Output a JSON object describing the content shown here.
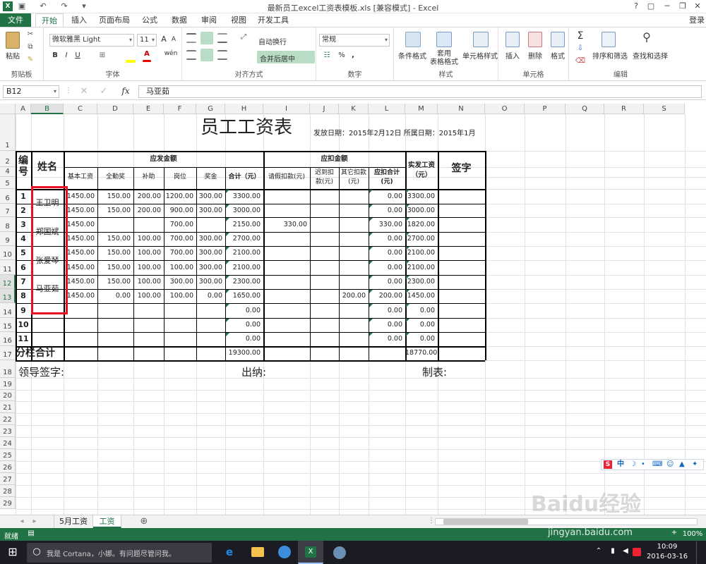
{
  "window": {
    "title": "最新员工excel工资表模板.xls  [兼容模式] - Excel",
    "help": "?",
    "login": "登录"
  },
  "tabs": [
    "文件",
    "开始",
    "插入",
    "页面布局",
    "公式",
    "数据",
    "审阅",
    "视图",
    "开发工具"
  ],
  "ribbon": {
    "clipboard": {
      "paste": "粘贴",
      "label": "剪贴板"
    },
    "font": {
      "name": "微软雅黑 Light",
      "size": "11",
      "label": "字体",
      "bold": "B",
      "italic": "I",
      "underline": "U",
      "grow": "A",
      "shrink": "A",
      "phonetic": "wén"
    },
    "align": {
      "wrap": "自动换行",
      "merge": "合并后居中",
      "label": "对齐方式"
    },
    "number": {
      "format": "常规",
      "label": "数字",
      "percent": "%",
      "comma": ","
    },
    "styles": {
      "cond": "条件格式",
      "table": "套用\n表格格式",
      "cell": "单元格样式",
      "label": "样式"
    },
    "cells": {
      "insert": "插入",
      "delete": "删除",
      "format": "格式",
      "label": "单元格"
    },
    "edit": {
      "sort": "排序和筛选",
      "find": "查找和选择",
      "label": "编辑",
      "sum": "Σ"
    }
  },
  "formula_bar": {
    "name_box": "B12",
    "fx": "fx",
    "value": "马亚茹"
  },
  "columns": [
    "A",
    "B",
    "C",
    "D",
    "E",
    "F",
    "G",
    "H",
    "I",
    "J",
    "K",
    "L",
    "M",
    "N",
    "O",
    "P",
    "Q",
    "R",
    "S"
  ],
  "rows": [
    "1",
    "2",
    "4",
    "5",
    "6",
    "7",
    "8",
    "9",
    "10",
    "11",
    "12",
    "13",
    "14",
    "15",
    "16",
    "17",
    "18",
    "19",
    "20",
    "21",
    "22",
    "23",
    "24",
    "25",
    "26",
    "27",
    "28",
    "29"
  ],
  "sheet": {
    "title": "员工工资表",
    "issue_date": "发放日期：2015年2月12日 所属日期：2015年1月",
    "h_no": "编\n号",
    "h_name": "姓名",
    "h_pay": "应发金额",
    "h_deduct": "应扣金额",
    "h_actual": "实发工资\n（元）",
    "h_sign": "签字",
    "sub": [
      "基本工资",
      "全勤奖",
      "补助",
      "岗位",
      "奖金",
      "合计（元）",
      "请假扣款(元)",
      "迟到扣\n款(元)",
      "其它扣款\n(元)",
      "应扣合计\n(元)"
    ],
    "rows": [
      {
        "no": "1",
        "base": "1450.00",
        "full": "150.00",
        "sub": "200.00",
        "post": "1200.00",
        "bonus": "300.00",
        "total": "3300.00",
        "leave": "",
        "late": "",
        "other": "",
        "ded": "0.00",
        "actual": "3300.00"
      },
      {
        "no": "2",
        "base": "1450.00",
        "full": "150.00",
        "sub": "200.00",
        "post": "900.00",
        "bonus": "300.00",
        "total": "3000.00",
        "leave": "",
        "late": "",
        "other": "",
        "ded": "0.00",
        "actual": "3000.00"
      },
      {
        "no": "3",
        "base": "1450.00",
        "full": "",
        "sub": "",
        "post": "700.00",
        "bonus": "",
        "total": "2150.00",
        "leave": "330.00",
        "late": "",
        "other": "",
        "ded": "330.00",
        "actual": "1820.00"
      },
      {
        "no": "4",
        "base": "1450.00",
        "full": "150.00",
        "sub": "100.00",
        "post": "700.00",
        "bonus": "300.00",
        "total": "2700.00",
        "leave": "",
        "late": "",
        "other": "",
        "ded": "0.00",
        "actual": "2700.00"
      },
      {
        "no": "5",
        "base": "1450.00",
        "full": "150.00",
        "sub": "100.00",
        "post": "700.00",
        "bonus": "300.00",
        "total": "2100.00",
        "leave": "",
        "late": "",
        "other": "",
        "ded": "0.00",
        "actual": "2100.00"
      },
      {
        "no": "6",
        "base": "1450.00",
        "full": "150.00",
        "sub": "100.00",
        "post": "100.00",
        "bonus": "300.00",
        "total": "2100.00",
        "leave": "",
        "late": "",
        "other": "",
        "ded": "0.00",
        "actual": "2100.00"
      },
      {
        "no": "7",
        "base": "1450.00",
        "full": "150.00",
        "sub": "100.00",
        "post": "300.00",
        "bonus": "300.00",
        "total": "2300.00",
        "leave": "",
        "late": "",
        "other": "",
        "ded": "0.00",
        "actual": "2300.00"
      },
      {
        "no": "8",
        "base": "1450.00",
        "full": "0.00",
        "sub": "100.00",
        "post": "100.00",
        "bonus": "0.00",
        "total": "1650.00",
        "leave": "",
        "late": "",
        "other": "200.00",
        "ded": "200.00",
        "actual": "1450.00"
      },
      {
        "no": "9",
        "base": "",
        "full": "",
        "sub": "",
        "post": "",
        "bonus": "",
        "total": "0.00",
        "leave": "",
        "late": "",
        "other": "",
        "ded": "0.00",
        "actual": "0.00"
      },
      {
        "no": "10",
        "base": "",
        "full": "",
        "sub": "",
        "post": "",
        "bonus": "",
        "total": "0.00",
        "leave": "",
        "late": "",
        "other": "",
        "ded": "0.00",
        "actual": "0.00"
      },
      {
        "no": "11",
        "base": "",
        "full": "",
        "sub": "",
        "post": "",
        "bonus": "",
        "total": "0.00",
        "leave": "",
        "late": "",
        "other": "",
        "ded": "0.00",
        "actual": "0.00"
      }
    ],
    "names": [
      "王卫明",
      "郑国斌",
      "张爱琴",
      "马亚茹"
    ],
    "sum_label": "分栏合计",
    "sum_total": "19300.00",
    "sum_actual": "18770.00",
    "sign_leader": "领导签字:",
    "sign_cashier": "出纳:",
    "sign_maker": "制表:"
  },
  "sheet_tabs": [
    "5月工资",
    "工资"
  ],
  "status": {
    "ready": "就绪",
    "zoom": "100%",
    "plus": "+"
  },
  "taskbar": {
    "search": "我是 Cortana，小娜。有问题尽管问我。",
    "time": "10:09",
    "date": "2016-03-16"
  },
  "ime": {
    "lang": "中"
  },
  "watermark": {
    "text": "Baidu经验",
    "url": "jingyan.baidu.com"
  }
}
